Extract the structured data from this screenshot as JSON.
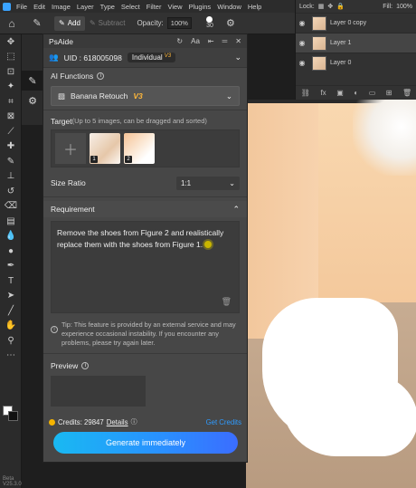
{
  "menubar": {
    "items": [
      "File",
      "Edit",
      "Image",
      "Layer",
      "Type",
      "Select",
      "Filter",
      "View",
      "Plugins",
      "Window",
      "Help"
    ]
  },
  "options": {
    "add": "Add",
    "subtract": "Subtract",
    "opacity_label": "Opacity:",
    "opacity_value": "100%",
    "brush_size": "30"
  },
  "layers": {
    "lock_label": "Lock:",
    "fill_label": "Fill:",
    "fill_value": "100%",
    "items": [
      {
        "name": "Layer 0 copy",
        "selected": false
      },
      {
        "name": "Layer 1",
        "selected": true
      },
      {
        "name": "Layer 0",
        "selected": false
      }
    ],
    "footer_icons": [
      "link-icon",
      "fx-icon",
      "mask-icon",
      "adjustment-icon",
      "folder-icon",
      "new-layer-icon",
      "trash-icon"
    ]
  },
  "panel": {
    "title": "PsAide",
    "uid": "UID : 618005098",
    "plan": "Individual",
    "plan_version": "V3",
    "ai_functions_label": "AI Functions",
    "function_name": "Banana Retouch",
    "function_version": "V3",
    "target_label": "Target",
    "target_sub": "(Up to 5 images, can be dragged and sorted)",
    "thumb_numbers": [
      "1",
      "2"
    ],
    "size_ratio_label": "Size Ratio",
    "size_ratio_value": "1:1",
    "requirement_label": "Requirement",
    "requirement_text": "Remove the shoes from Figure 2 and realistically replace them with the shoes from Figure 1.",
    "tip": "Tip: This feature is provided by an external service and may experience occasional instability. If you encounter any problems, please try again later.",
    "preview_label": "Preview",
    "credits": "Credits: 29847",
    "details": "Details",
    "get_credits": "Get Credits",
    "generate": "Generate immediately"
  },
  "toolbar": {
    "version": "Beta V25.3.0"
  },
  "colors": {
    "accent": "#2a8fff",
    "gold": "#ffb73a",
    "panel_bg": "#474747"
  }
}
